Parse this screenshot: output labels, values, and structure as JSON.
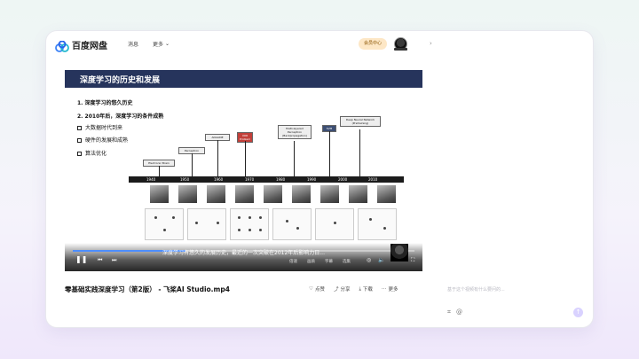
{
  "header": {
    "logo_text": "百度网盘",
    "nav": [
      {
        "label": "消息"
      },
      {
        "label": "更多"
      }
    ],
    "vip_label": "会员中心"
  },
  "slide": {
    "title": "深度学习的历史和发展",
    "lines": [
      "1. 深度学习的悠久历史",
      "2. 2010年后，深度学习的条件成熟",
      "大数据时代到来",
      "硬件的发展和成熟",
      "算法优化"
    ],
    "timeline_boxes": [
      {
        "label": "Electronic Brain",
        "style": "plain"
      },
      {
        "label": "Perceptron",
        "style": "plain"
      },
      {
        "label": "ADALINE",
        "style": "plain"
      },
      {
        "label": "XOR Problem",
        "style": "red"
      },
      {
        "label": "Multi-layered Perceptron (Backpropagation)",
        "style": "plain"
      },
      {
        "label": "SVM",
        "style": "dark"
      },
      {
        "label": "Deep Neural Network (Pretraining)",
        "style": "plain"
      }
    ],
    "years": [
      "1940",
      "1950",
      "1960",
      "1970",
      "1980",
      "1990",
      "2000",
      "2010"
    ]
  },
  "player": {
    "caption": "深度学习有悠久的发展历史，最近的一次突破在2012年后影响力日...",
    "progress": 0.33,
    "controls": [
      "倍速",
      "画质",
      "字幕",
      "选集"
    ]
  },
  "video": {
    "title": "零基础实践深度学习（第2版） - 飞桨AI Studio.mp4",
    "actions": [
      "点赞",
      "分享",
      "下载",
      "更多"
    ]
  },
  "ai_panel": {
    "input_placeholder": "基于这个视频有什么要问的..."
  },
  "colors": {
    "accent": "#4d8eff",
    "slide_header": "#26345c",
    "vip_bg": "#fde7c6"
  }
}
